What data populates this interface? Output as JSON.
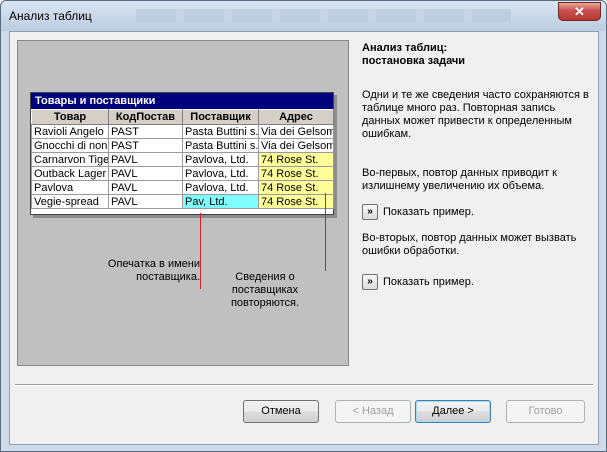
{
  "window": {
    "title": "Анализ таблиц",
    "close_label": "✕"
  },
  "preview": {
    "table_title": "Товары и поставщики",
    "columns": [
      "Товар",
      "КодПостав",
      "Поставщик",
      "Адрес"
    ],
    "rows": [
      [
        "Ravioli Angelo",
        "PAST",
        "Pasta Buttini s.r.l.",
        "Via dei Gelsomini"
      ],
      [
        "Gnocchi di nonna",
        "PAST",
        "Pasta Buttini s.r.l.",
        "Via dei Gelsomini"
      ],
      [
        "Carnarvon Tigers",
        "PAVL",
        "Pavlova, Ltd.",
        "74 Rose St."
      ],
      [
        "Outback Lager",
        "PAVL",
        "Pavlova, Ltd.",
        "74 Rose St."
      ],
      [
        "Pavlova",
        "PAVL",
        "Pavlova, Ltd.",
        "74 Rose St."
      ],
      [
        "Vegie-spread",
        "PAVL",
        "Pav, Ltd.",
        "74 Rose St."
      ]
    ],
    "note_typo": [
      "Опечатка в имени",
      "поставщика."
    ],
    "note_repeat": [
      "Сведения о",
      "поставщиках",
      "повторяются."
    ],
    "highlight_colors": {
      "repeat": "#ffff99",
      "typo": "#80ffff",
      "pointer": "#d32020"
    }
  },
  "info": {
    "heading_line1": "Анализ таблиц:",
    "heading_line2": "постановка задачи",
    "para1": [
      "Одни и те же сведения часто сохраняются в",
      " таблице много раз. Повторная запись",
      "данных может привести к определенным",
      "ошибкам."
    ],
    "para2": [
      "Во-первых, повтор данных приводит к",
      "излишнему увеличению их объема."
    ],
    "show_example_1": "Показать пример.",
    "para3": [
      "Во-вторых, повтор данных может вызвать",
      "ошибки обработки."
    ],
    "show_example_2": "Показать пример.",
    "show_btn_glyph": "»"
  },
  "buttons": {
    "cancel": "Отмена",
    "back": "< Назад",
    "next": "Далее >",
    "finish": "Готово"
  }
}
